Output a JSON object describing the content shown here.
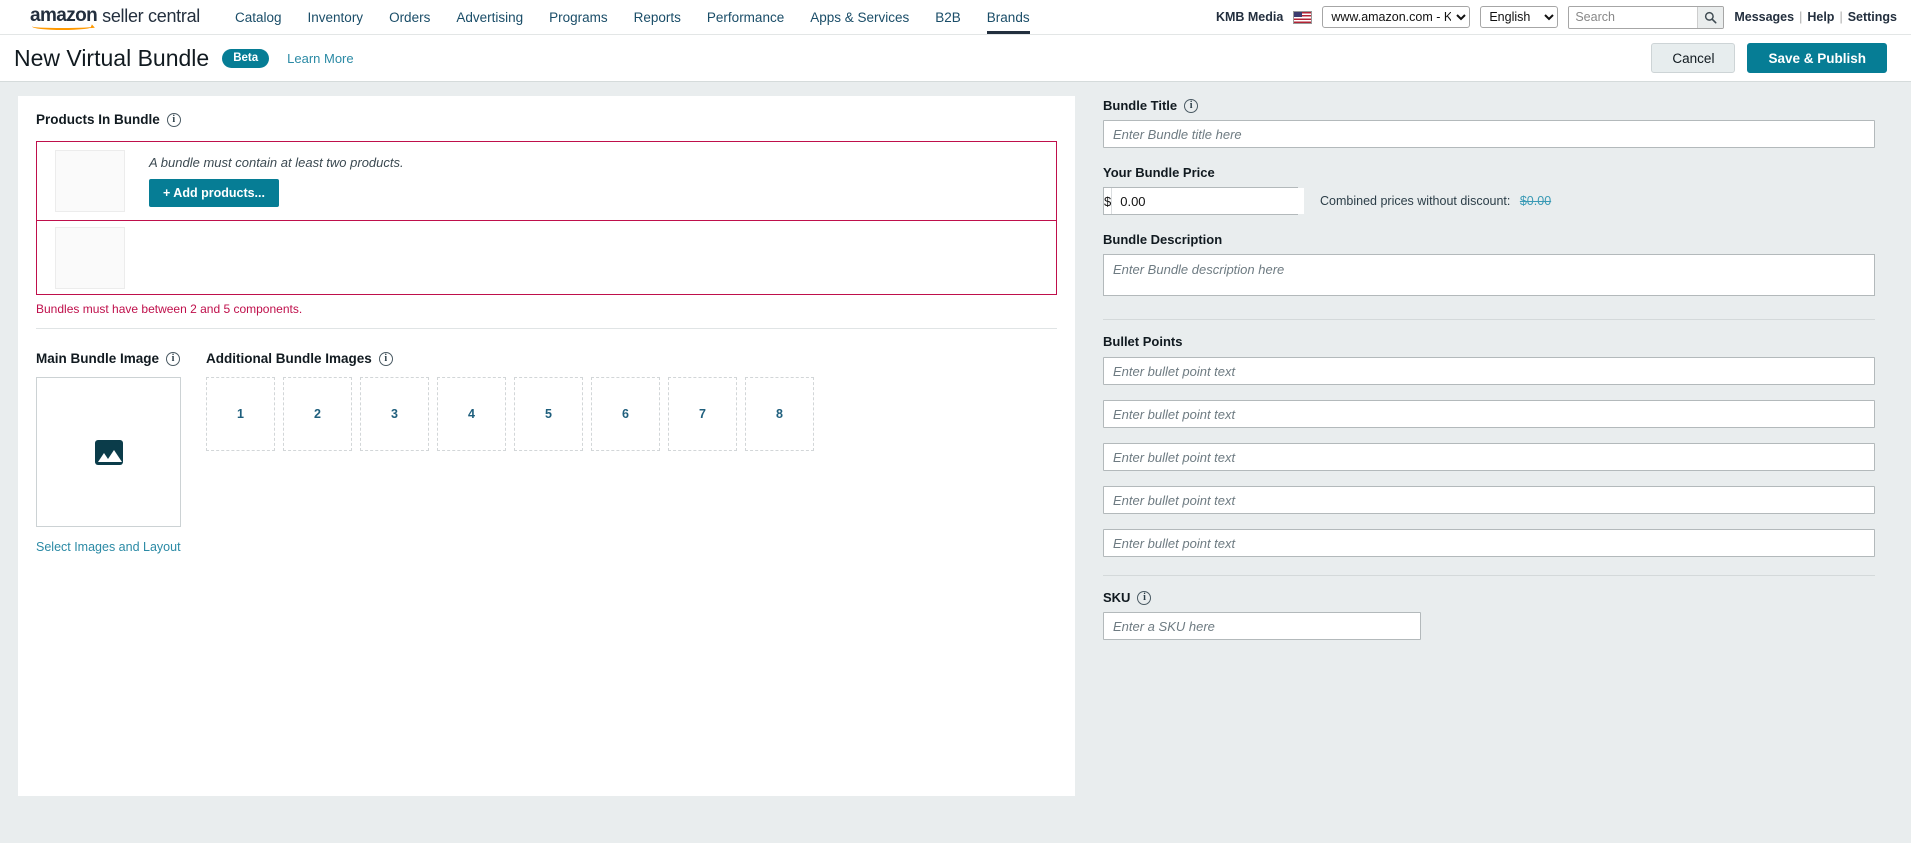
{
  "topnav": {
    "logo_primary": "amazon",
    "logo_secondary": "seller central",
    "links": [
      {
        "label": "Catalog",
        "active": false
      },
      {
        "label": "Inventory",
        "active": false
      },
      {
        "label": "Orders",
        "active": false
      },
      {
        "label": "Advertising",
        "active": false
      },
      {
        "label": "Programs",
        "active": false
      },
      {
        "label": "Reports",
        "active": false
      },
      {
        "label": "Performance",
        "active": false
      },
      {
        "label": "Apps & Services",
        "active": false
      },
      {
        "label": "B2B",
        "active": false
      },
      {
        "label": "Brands",
        "active": true
      }
    ],
    "account_name": "KMB Media",
    "flag_icon": "us-flag-icon",
    "marketplace_selected": "www.amazon.com - KMB M",
    "language_selected": "English",
    "search_placeholder": "Search",
    "search_value": "",
    "search_icon": "search-icon",
    "messages_label": "Messages",
    "help_label": "Help",
    "settings_label": "Settings",
    "separator": "|"
  },
  "header": {
    "title": "New Virtual Bundle",
    "beta_badge": "Beta",
    "learn_more": "Learn More",
    "cancel_label": "Cancel",
    "publish_label": "Save & Publish"
  },
  "colors": {
    "accent_teal": "#067d95",
    "link_teal": "#2b8aa5",
    "error_crimson": "#bf0f4b",
    "nav_dark": "#232f3e",
    "brand_orange": "#ff9900",
    "page_bg": "#e9edee",
    "strikethrough_teal": "#3a9ab5"
  },
  "products_section": {
    "heading": "Products In Bundle",
    "info_icon": "info-icon",
    "empty_message": "A bundle must contain at least two products.",
    "add_products_label": "+ Add products...",
    "error_message": "Bundles must have between 2 and 5 components.",
    "rows": [
      {
        "thumb": "product-thumb-placeholder",
        "has_message": true
      },
      {
        "thumb": "product-thumb-placeholder",
        "has_message": false
      }
    ]
  },
  "main_image": {
    "heading": "Main Bundle Image",
    "info_icon": "info-icon",
    "placeholder_icon": "picture-icon",
    "select_link": "Select Images and Layout"
  },
  "additional_images": {
    "heading": "Additional Bundle Images",
    "info_icon": "info-icon",
    "slots": [
      "1",
      "2",
      "3",
      "4",
      "5",
      "6",
      "7",
      "8"
    ]
  },
  "bundle_title": {
    "label": "Bundle Title",
    "info_icon": "info-icon",
    "placeholder": "Enter Bundle title here",
    "value": ""
  },
  "bundle_price": {
    "label": "Your Bundle Price",
    "currency_symbol": "$",
    "value": "0.00",
    "combined_label": "Combined prices without discount:",
    "combined_value": "$0.00"
  },
  "bundle_description": {
    "label": "Bundle Description",
    "placeholder": "Enter Bundle description here",
    "value": ""
  },
  "bullet_points": {
    "label": "Bullet Points",
    "items": [
      {
        "placeholder": "Enter bullet point text",
        "value": ""
      },
      {
        "placeholder": "Enter bullet point text",
        "value": ""
      },
      {
        "placeholder": "Enter bullet point text",
        "value": ""
      },
      {
        "placeholder": "Enter bullet point text",
        "value": ""
      },
      {
        "placeholder": "Enter bullet point text",
        "value": ""
      }
    ]
  },
  "sku": {
    "label": "SKU",
    "info_icon": "info-icon",
    "placeholder": "Enter a SKU here",
    "value": ""
  }
}
